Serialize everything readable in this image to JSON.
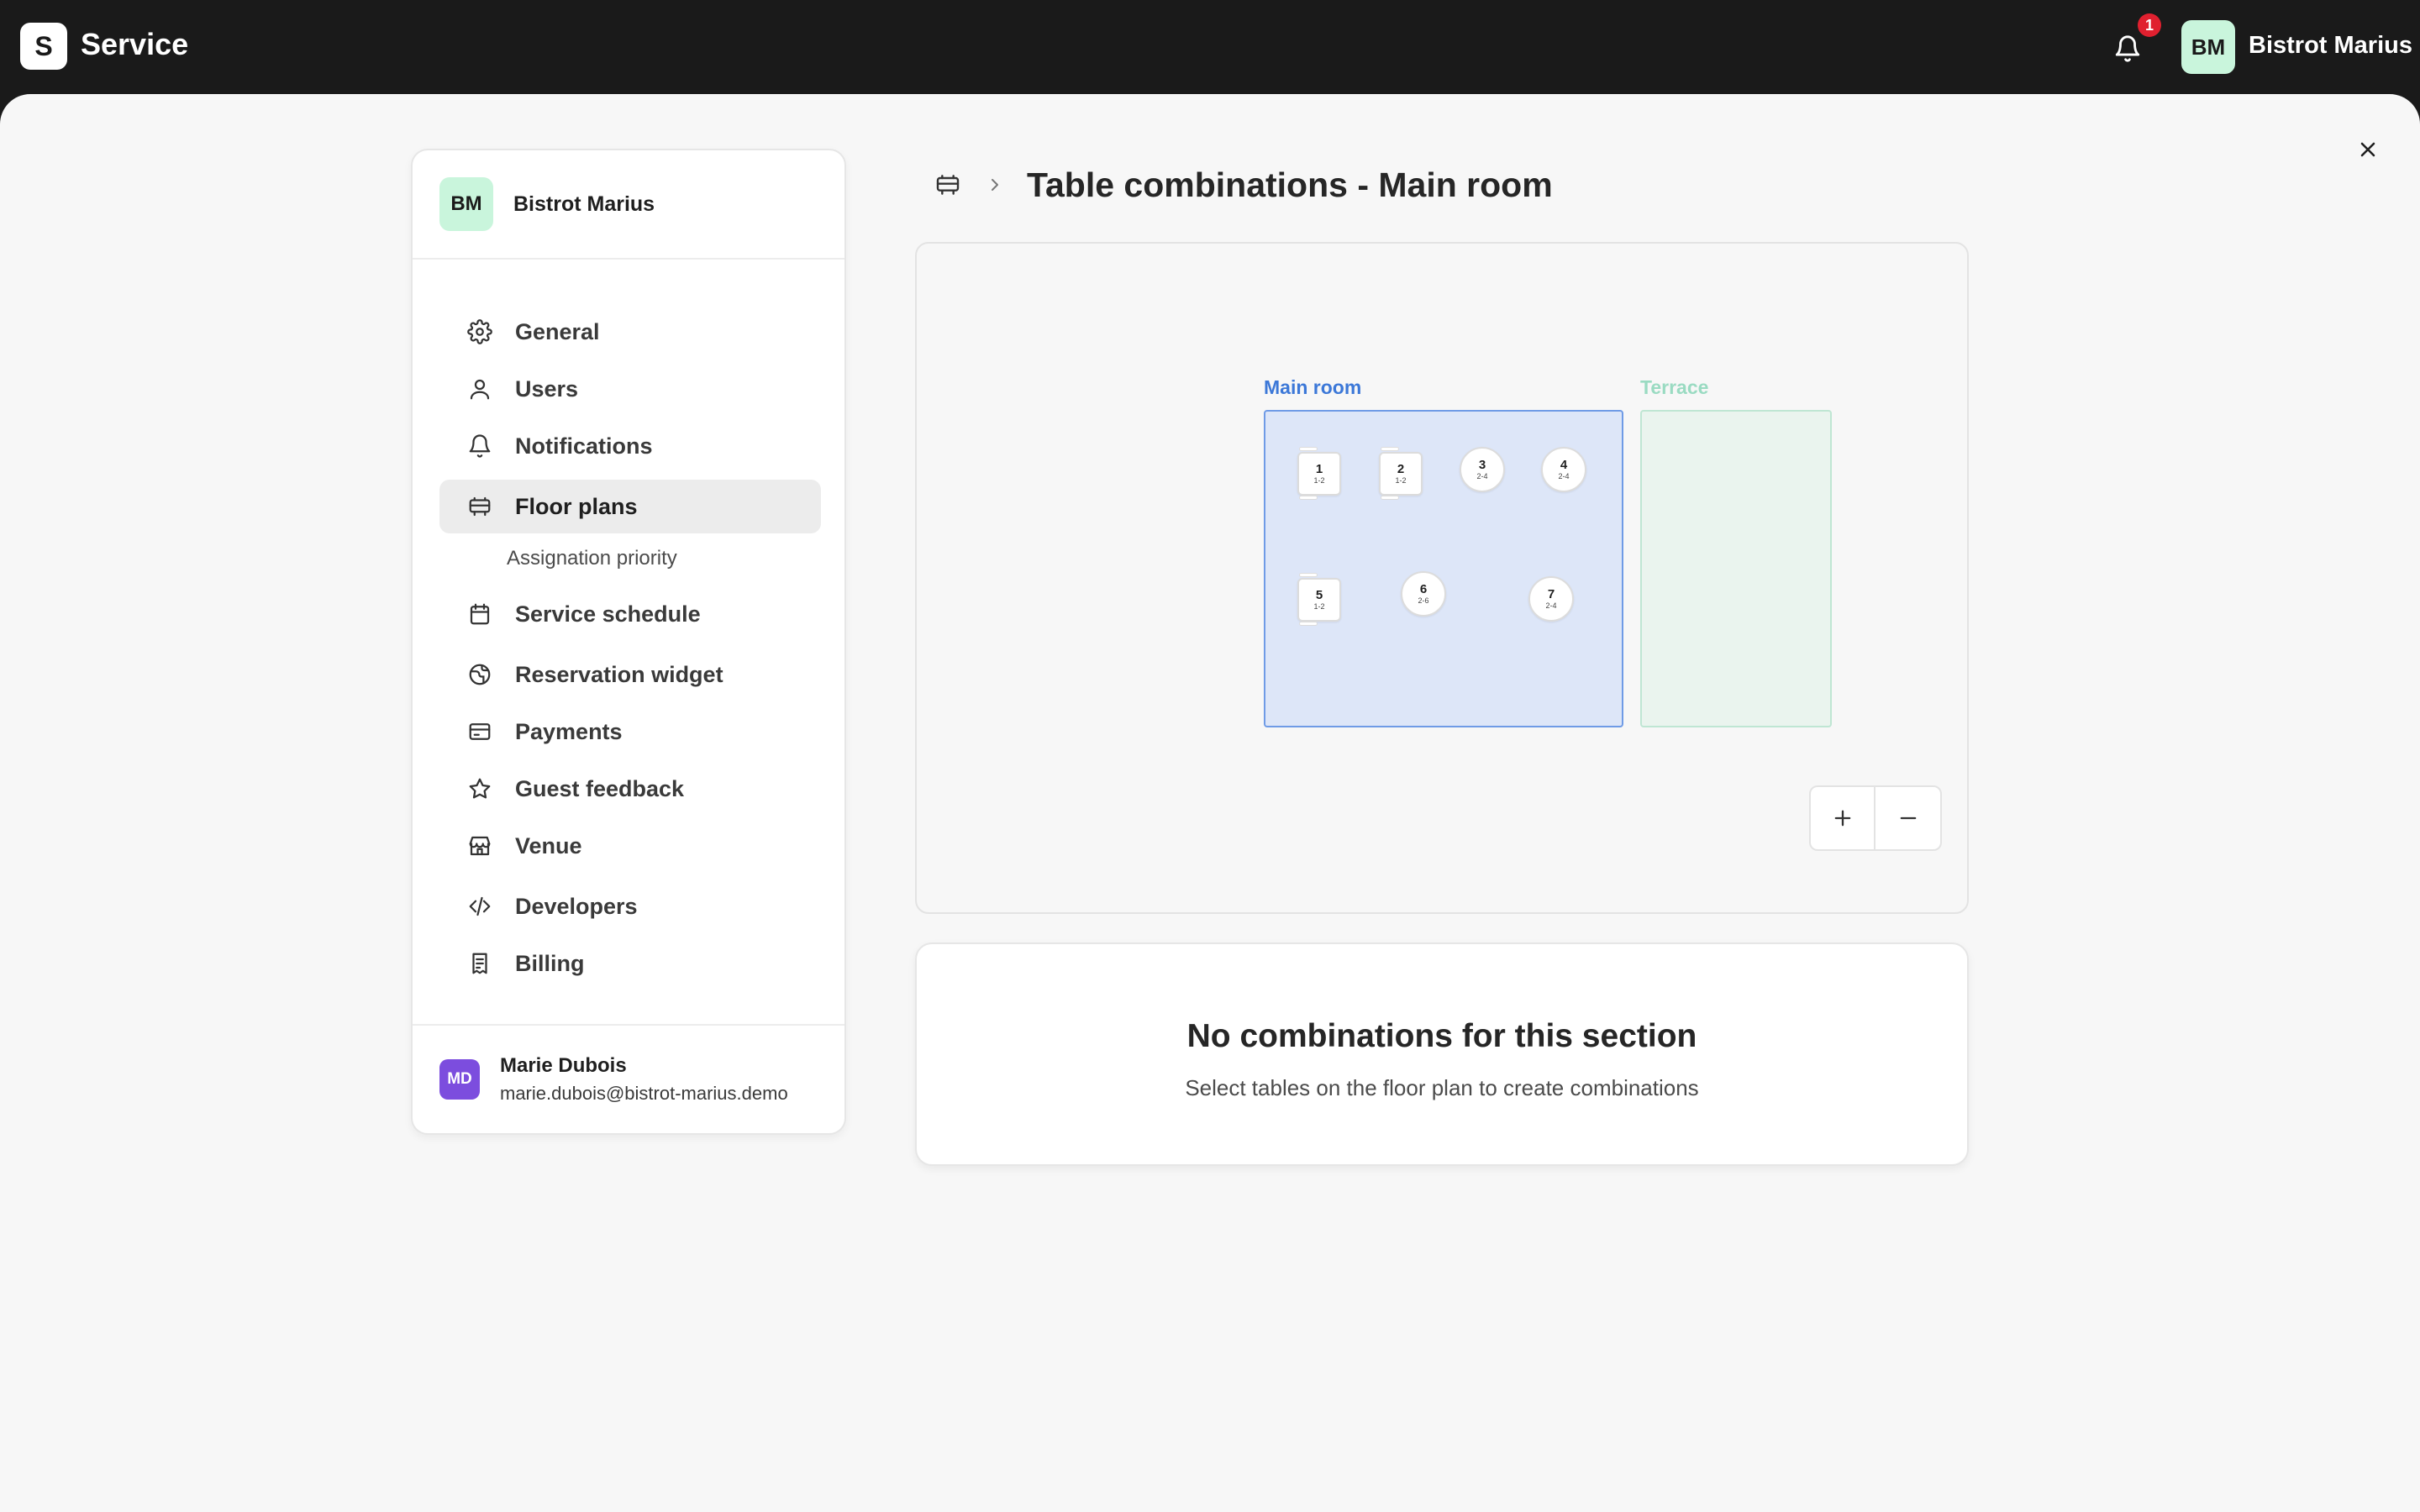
{
  "app": {
    "logo_letter": "S",
    "name": "Service"
  },
  "topbar": {
    "notification_count": "1",
    "avatar_initials": "BM",
    "venue_name": "Bistrot Marius"
  },
  "sidebar": {
    "venue_initials": "BM",
    "venue_name": "Bistrot Marius",
    "items": [
      {
        "label": "General",
        "icon": "gear-icon"
      },
      {
        "label": "Users",
        "icon": "user-icon"
      },
      {
        "label": "Notifications",
        "icon": "bell-icon"
      },
      {
        "label": "Floor plans",
        "icon": "floor-plan-icon",
        "active": true
      },
      {
        "label": "Service schedule",
        "icon": "calendar-icon"
      },
      {
        "label": "Reservation widget",
        "icon": "globe-icon"
      },
      {
        "label": "Payments",
        "icon": "credit-card-icon"
      },
      {
        "label": "Guest feedback",
        "icon": "star-icon"
      },
      {
        "label": "Venue",
        "icon": "store-icon"
      },
      {
        "label": "Developers",
        "icon": "code-icon"
      },
      {
        "label": "Billing",
        "icon": "receipt-icon"
      }
    ],
    "subitem": {
      "label": "Assignation priority"
    },
    "user": {
      "initials": "MD",
      "name": "Marie Dubois",
      "email": "marie.dubois@bistrot-marius.demo"
    }
  },
  "header": {
    "title": "Table combinations - Main room"
  },
  "floorplan": {
    "sections": [
      {
        "name": "Main room",
        "state": "selected",
        "color": "#3c78d8"
      },
      {
        "name": "Terrace",
        "state": "inactive",
        "color": "#9adbc2"
      }
    ],
    "tables": [
      {
        "number": "1",
        "capacity": "1-2",
        "shape": "square"
      },
      {
        "number": "2",
        "capacity": "1-2",
        "shape": "square"
      },
      {
        "number": "3",
        "capacity": "2-4",
        "shape": "round"
      },
      {
        "number": "4",
        "capacity": "2-4",
        "shape": "round"
      },
      {
        "number": "5",
        "capacity": "1-2",
        "shape": "square"
      },
      {
        "number": "6",
        "capacity": "2-6",
        "shape": "round"
      },
      {
        "number": "7",
        "capacity": "2-4",
        "shape": "round"
      }
    ],
    "zoom_in_icon": "plus-icon",
    "zoom_out_icon": "minus-icon"
  },
  "empty_state": {
    "title": "No combinations for this section",
    "subtitle": "Select tables on the floor plan to create combinations"
  }
}
